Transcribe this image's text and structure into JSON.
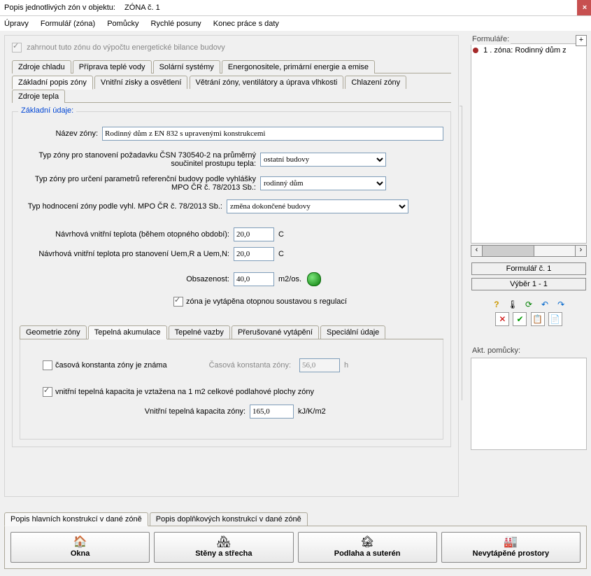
{
  "title": {
    "prefix": "Popis jednotlivých zón v objektu:",
    "zone": "ZÓNA č. 1"
  },
  "close_label": "×",
  "menu": {
    "upravy": "Úpravy",
    "formular": "Formulář (zóna)",
    "pomucky": "Pomůcky",
    "rychle": "Rychlé posuny",
    "konec": "Konec práce s daty"
  },
  "include_checkbox": {
    "label": "zahrnout tuto zónu do výpočtu energetické bilance budovy",
    "checked": true
  },
  "tabs_top": {
    "chlad": "Zdroje chladu",
    "voda": "Příprava teplé vody",
    "solar": "Solární systémy",
    "energo": "Energonositele, primární energie a emise"
  },
  "tabs_bottom": {
    "zaklad": "Základní popis zóny",
    "zisky": "Vnitřní zisky a osvětlení",
    "vetrani": "Větrání zóny, ventilátory a úprava vlhkosti",
    "chlazeni": "Chlazení zóny",
    "tepla": "Zdroje tepla"
  },
  "fieldset_legend": "Základní údaje:",
  "form": {
    "nazev_label": "Název zóny:",
    "nazev_value": "Rodinný dům z EN 832 s upravenými konstrukcemi",
    "typ1_label": "Typ zóny pro stanovení požadavku ČSN 730540-2 na průměrný součinitel prostupu tepla:",
    "typ1_value": "ostatní budovy",
    "typ2_label": "Typ zóny pro určení parametrů referenční budovy podle vyhlášky MPO ČR č. 78/2013 Sb.:",
    "typ2_value": "rodinný dům",
    "typ3_label": "Typ hodnocení zóny podle vyhl. MPO ČR č. 78/2013 Sb.:",
    "typ3_value": "změna dokončené budovy",
    "temp1_label": "Návrhová vnitřní teplota (během otopného období):",
    "temp1_value": "20,0",
    "temp1_unit": "C",
    "temp2_label": "Návrhová vnitřní teplota pro stanovení Uem,R a Uem,N:",
    "temp2_value": "20,0",
    "temp2_unit": "C",
    "obs_label": "Obsazenost:",
    "obs_value": "40,0",
    "obs_unit": "m2/os.",
    "heated_label": "zóna je vytápěna otopnou soustavou s regulací",
    "heated_checked": true
  },
  "subtabs": {
    "geom": "Geometrie zóny",
    "akum": "Tepelná akumulace",
    "vazby": "Tepelné vazby",
    "prerus": "Přerušované vytápění",
    "spec": "Speciální údaje"
  },
  "akum": {
    "ck1_label": "časová konstanta zóny je známa",
    "ck1_checked": false,
    "const_label": "Časová konstanta zóny:",
    "const_value": "56,0",
    "const_unit": "h",
    "ck2_label": "vnitřní tepelná kapacita je vztažena na 1 m2 celkové podlahové plochy zóny",
    "ck2_checked": true,
    "cap_label": "Vnitřní tepelná kapacita zóny:",
    "cap_value": "165,0",
    "cap_unit": "kJ/K/m2"
  },
  "right": {
    "formulare_label": "Formuláře:",
    "add": "+",
    "item1": "1 . zóna: Rodinný dům z",
    "btn_form": "Formulář č.  1",
    "btn_vyber": "Výběr  1 - 1",
    "help_label": "Akt. pomůcky:"
  },
  "toolbar": {
    "t1": "?",
    "t2": "🌡",
    "t3": "⟳",
    "t4": "↶",
    "t5": "↷",
    "t6": "✕",
    "t7": "✔",
    "t8": "📋",
    "t9": "📄"
  },
  "bottom_tabs": {
    "t1": "Popis hlavních konstrukcí v dané zóně",
    "t2": "Popis doplňkových konstrukcí v dané zóně"
  },
  "bigbtns": {
    "okna": {
      "icon": "🏠",
      "label": "Okna"
    },
    "steny": {
      "icon": "🏘",
      "label": "Stěny a střecha"
    },
    "podlaha": {
      "icon": "🏚",
      "label": "Podlaha a suterén"
    },
    "nevyt": {
      "icon": "🏭",
      "label": "Nevytápěné prostory"
    }
  }
}
